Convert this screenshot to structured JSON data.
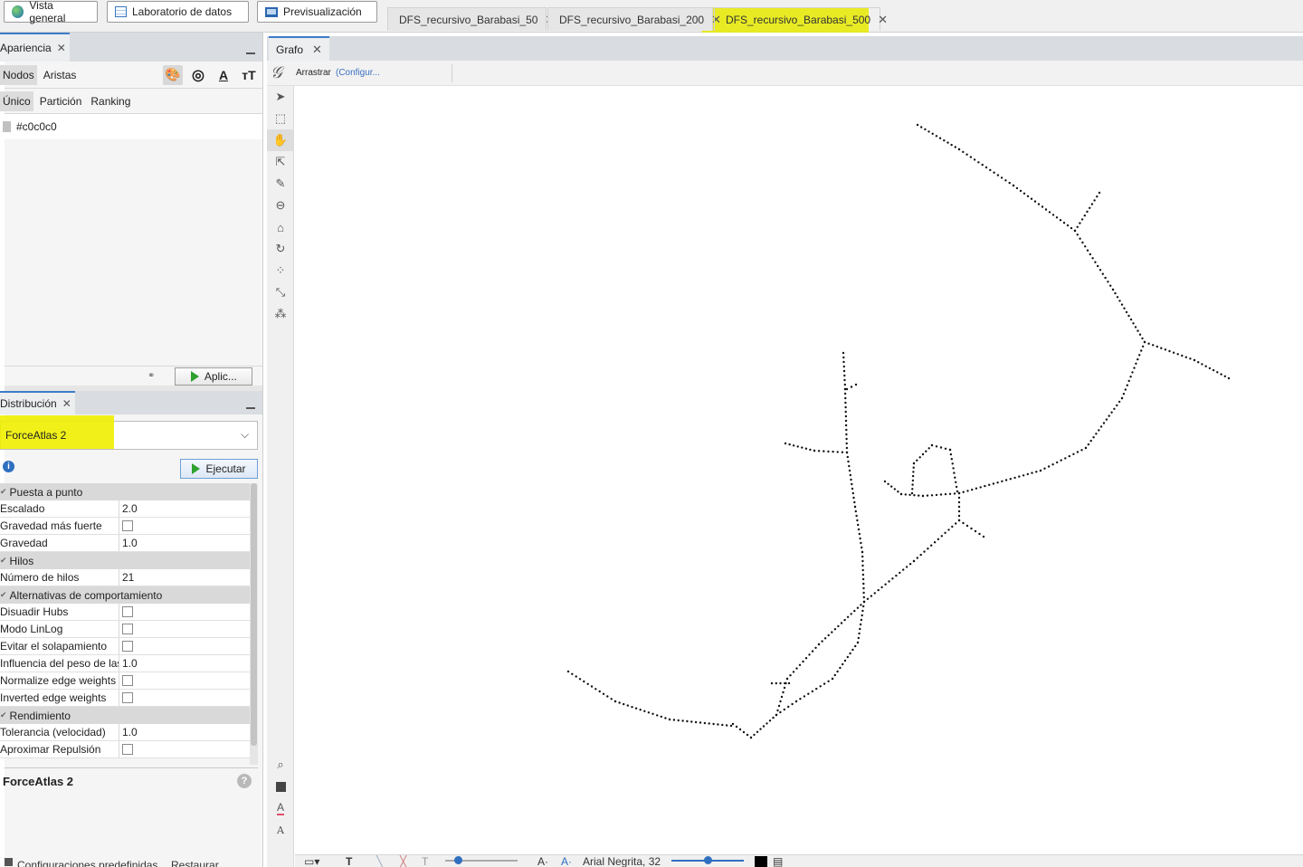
{
  "topbar": {
    "buttons": [
      {
        "label": "Vista general",
        "icon": "globe-icon"
      },
      {
        "label": "Laboratorio de datos",
        "icon": "table-icon"
      },
      {
        "label": "Previsualización",
        "icon": "monitor-icon"
      }
    ],
    "workspace_tabs": [
      {
        "label": "DFS_recursivo_Barabasi_50",
        "active": false
      },
      {
        "label": "DFS_recursivo_Barabasi_200",
        "active": false
      },
      {
        "label": "DFS_recursivo_Barabasi_500",
        "active": true
      }
    ],
    "highlight_color": "#e6ea00"
  },
  "appearance": {
    "title": "Apariencia",
    "element_tabs": [
      "Nodos",
      "Aristas"
    ],
    "mode_tabs": [
      "Único",
      "Partición",
      "Ranking"
    ],
    "color_value": "#c0c0c0",
    "apply_label": "Aplic..."
  },
  "layout": {
    "title": "Distribución",
    "algorithm": "ForceAtlas 2",
    "run_label": "Ejecutar",
    "sections": [
      {
        "name": "Puesta a punto",
        "rows": [
          {
            "key": "Escalado",
            "value": "2.0"
          },
          {
            "key": "Gravedad más fuerte",
            "checkbox": true
          },
          {
            "key": "Gravedad",
            "value": "1.0"
          }
        ]
      },
      {
        "name": "Hilos",
        "rows": [
          {
            "key": "Número de hilos",
            "value": "21"
          }
        ]
      },
      {
        "name": "Alternativas de comportamiento",
        "rows": [
          {
            "key": "Disuadir Hubs",
            "checkbox": true
          },
          {
            "key": "Modo LinLog",
            "checkbox": true
          },
          {
            "key": "Evitar el solapamiento",
            "checkbox": true
          },
          {
            "key": "Influencia del peso de las",
            "value": "1.0"
          },
          {
            "key": "Normalize edge weights",
            "checkbox": true
          },
          {
            "key": "Inverted edge weights",
            "checkbox": true
          }
        ]
      },
      {
        "name": "Rendimiento",
        "rows": [
          {
            "key": "Tolerancia (velocidad)",
            "value": "1.0"
          },
          {
            "key": "Aproximar Repulsión",
            "checkbox": true
          }
        ]
      }
    ],
    "description_title": "ForceAtlas 2",
    "footer": [
      "Configuraciones predefinidas...",
      "Restaurar"
    ]
  },
  "graph": {
    "tab_label": "Grafo",
    "tool_label": "Arrastrar",
    "config_link": "(Configur...",
    "font_label": "Arial Negrita, 32"
  }
}
